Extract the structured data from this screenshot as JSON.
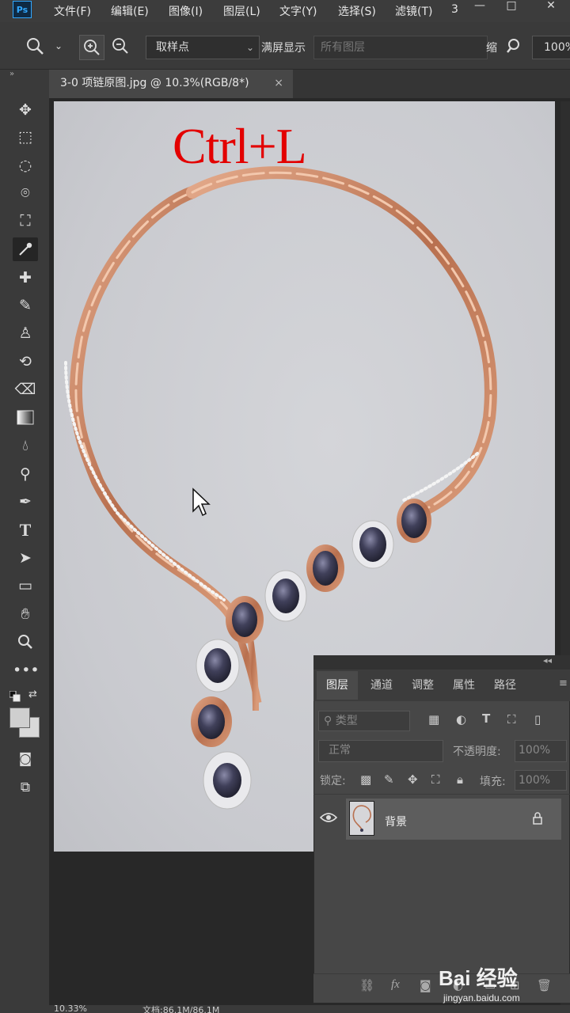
{
  "app": {
    "logo": "Ps"
  },
  "menu": {
    "items": [
      "文件(F)",
      "编辑(E)",
      "图像(I)",
      "图层(L)",
      "文字(Y)",
      "选择(S)",
      "滤镜(T)",
      "3"
    ]
  },
  "window_controls": {
    "minimize": "—",
    "maximize": "□",
    "close": "✕"
  },
  "options": {
    "sample_label": "取样点",
    "fullscreen_label": "满屏显示",
    "layers_placeholder": "所有图层",
    "shrink_label": "缩",
    "zoom_value": "100%"
  },
  "document": {
    "tab_title": "3-0 项链原图.jpg @ 10.3%(RGB/8*)",
    "close": "×",
    "overlay_text": "Ctrl+L"
  },
  "status": {
    "zoom": "10.33%",
    "doc": "文档:86.1M/86.1M"
  },
  "layers_panel": {
    "tabs": [
      "图层",
      "通道",
      "调整",
      "属性",
      "路径"
    ],
    "filter_label": "类型",
    "blend_mode": "正常",
    "opacity_label": "不透明度:",
    "opacity_value": "100%",
    "lock_label": "锁定:",
    "fill_label": "填充:",
    "fill_value": "100%",
    "layer_name": "背景"
  },
  "watermark": {
    "main": "Bai 经验",
    "sub": "jingyan.baidu.com"
  },
  "colors": {
    "accent": "#31a8ff",
    "overlay_red": "#e30000",
    "canvas_bg": "#cdced3",
    "chain": "#c98a64",
    "gem": "#3a3a52"
  }
}
